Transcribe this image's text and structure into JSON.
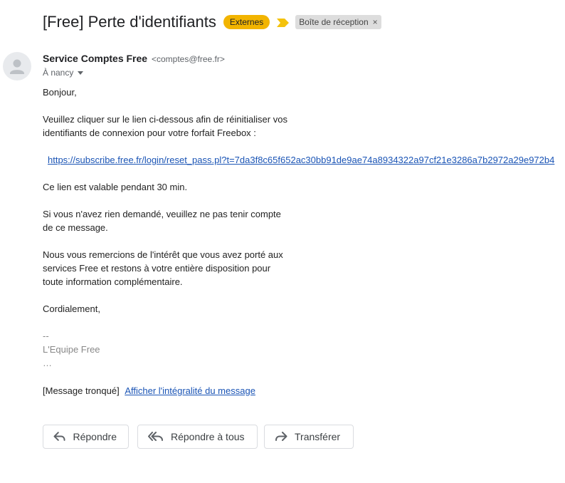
{
  "email": {
    "subject": "[Free] Perte d'identifiants",
    "labels": {
      "externes": "Externes",
      "inbox": "Boîte de réception",
      "inbox_remove": "×"
    },
    "sender": {
      "name": "Service Comptes Free",
      "email": "<comptes@free.fr>"
    },
    "recipient": "À nancy",
    "body": {
      "greeting": "Bonjour,",
      "intro_line1": "Veuillez cliquer sur le lien ci-dessous afin de réinitialiser vos",
      "intro_line2": "identifiants de connexion pour votre forfait Freebox :",
      "reset_link": "https://subscribe.free.fr/login/reset_pass.pl?t=7da3f8c65f652ac30bb91de9ae74a8934322a97cf21e3286a7b2972a29e972b4",
      "validity": "Ce lien est valable pendant 30 min.",
      "ignore_line1": "Si vous n'avez rien demandé, veuillez ne pas tenir compte",
      "ignore_line2": "de ce message.",
      "thanks_line1": "Nous vous remercions de l'intérêt que vous avez porté aux",
      "thanks_line2": "services Free et restons à votre entière disposition pour",
      "thanks_line3": "toute information complémentaire.",
      "closing": "Cordialement,",
      "sig_dash": "--",
      "sig_team": "L'Equipe Free",
      "ellipsis": "…",
      "truncated": "[Message tronqué]",
      "show_full": "Afficher l'intégralité du message"
    }
  },
  "actions": {
    "reply": "Répondre",
    "reply_all": "Répondre à tous",
    "forward": "Transférer"
  },
  "colors": {
    "externes_label": "#f2b400",
    "importance_marker": "#f4c20d",
    "link": "#1a54b5"
  },
  "icons": {
    "importance": "importance-marker-icon",
    "avatar": "default-avatar-icon",
    "caret": "caret-down-icon",
    "reply": "reply-icon",
    "reply_all": "reply-all-icon",
    "forward": "forward-icon"
  }
}
